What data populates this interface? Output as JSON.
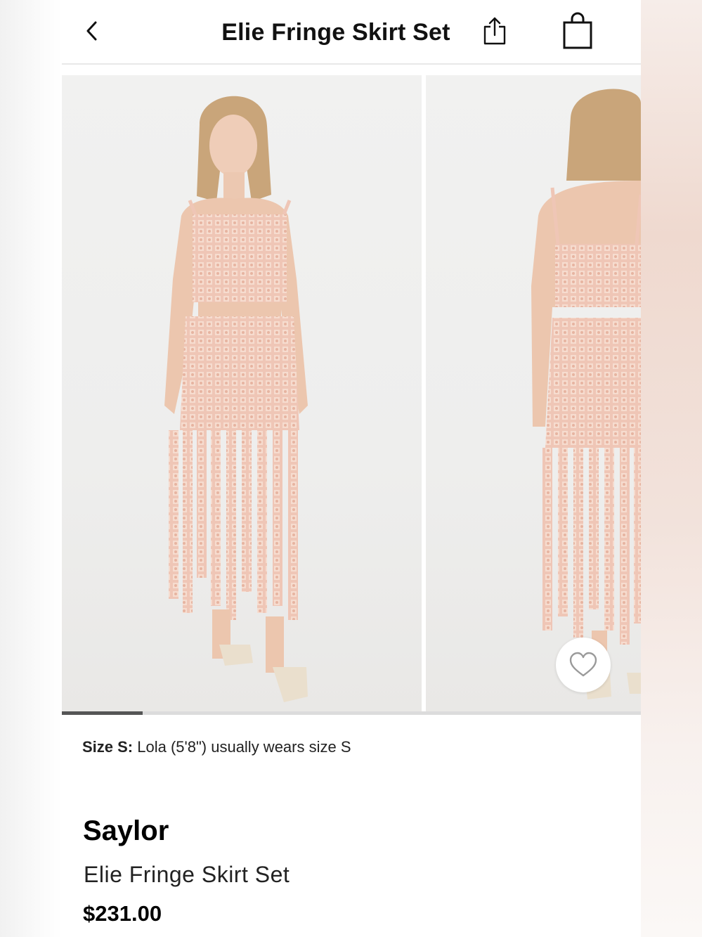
{
  "header": {
    "title": "Elie Fringe Skirt Set"
  },
  "gallery": {
    "image_count_visible": 2,
    "progress": 0.14,
    "images": [
      {
        "alt": "model front view wearing pink fringe crop top and skirt"
      },
      {
        "alt": "model back view wearing pink fringe crop top and skirt"
      }
    ]
  },
  "size_note": {
    "label": "Size S:",
    "text": "Lola (5'8\") usually wears size S"
  },
  "product": {
    "brand": "Saylor",
    "name": "Elie Fringe Skirt Set",
    "price": "$231.00"
  },
  "colors": {
    "garment": "#efc9b9",
    "background": "#f0f0ef",
    "text": "#111111"
  },
  "icons": [
    "back-chevron-icon",
    "share-icon",
    "shopping-bag-icon",
    "heart-icon"
  ]
}
